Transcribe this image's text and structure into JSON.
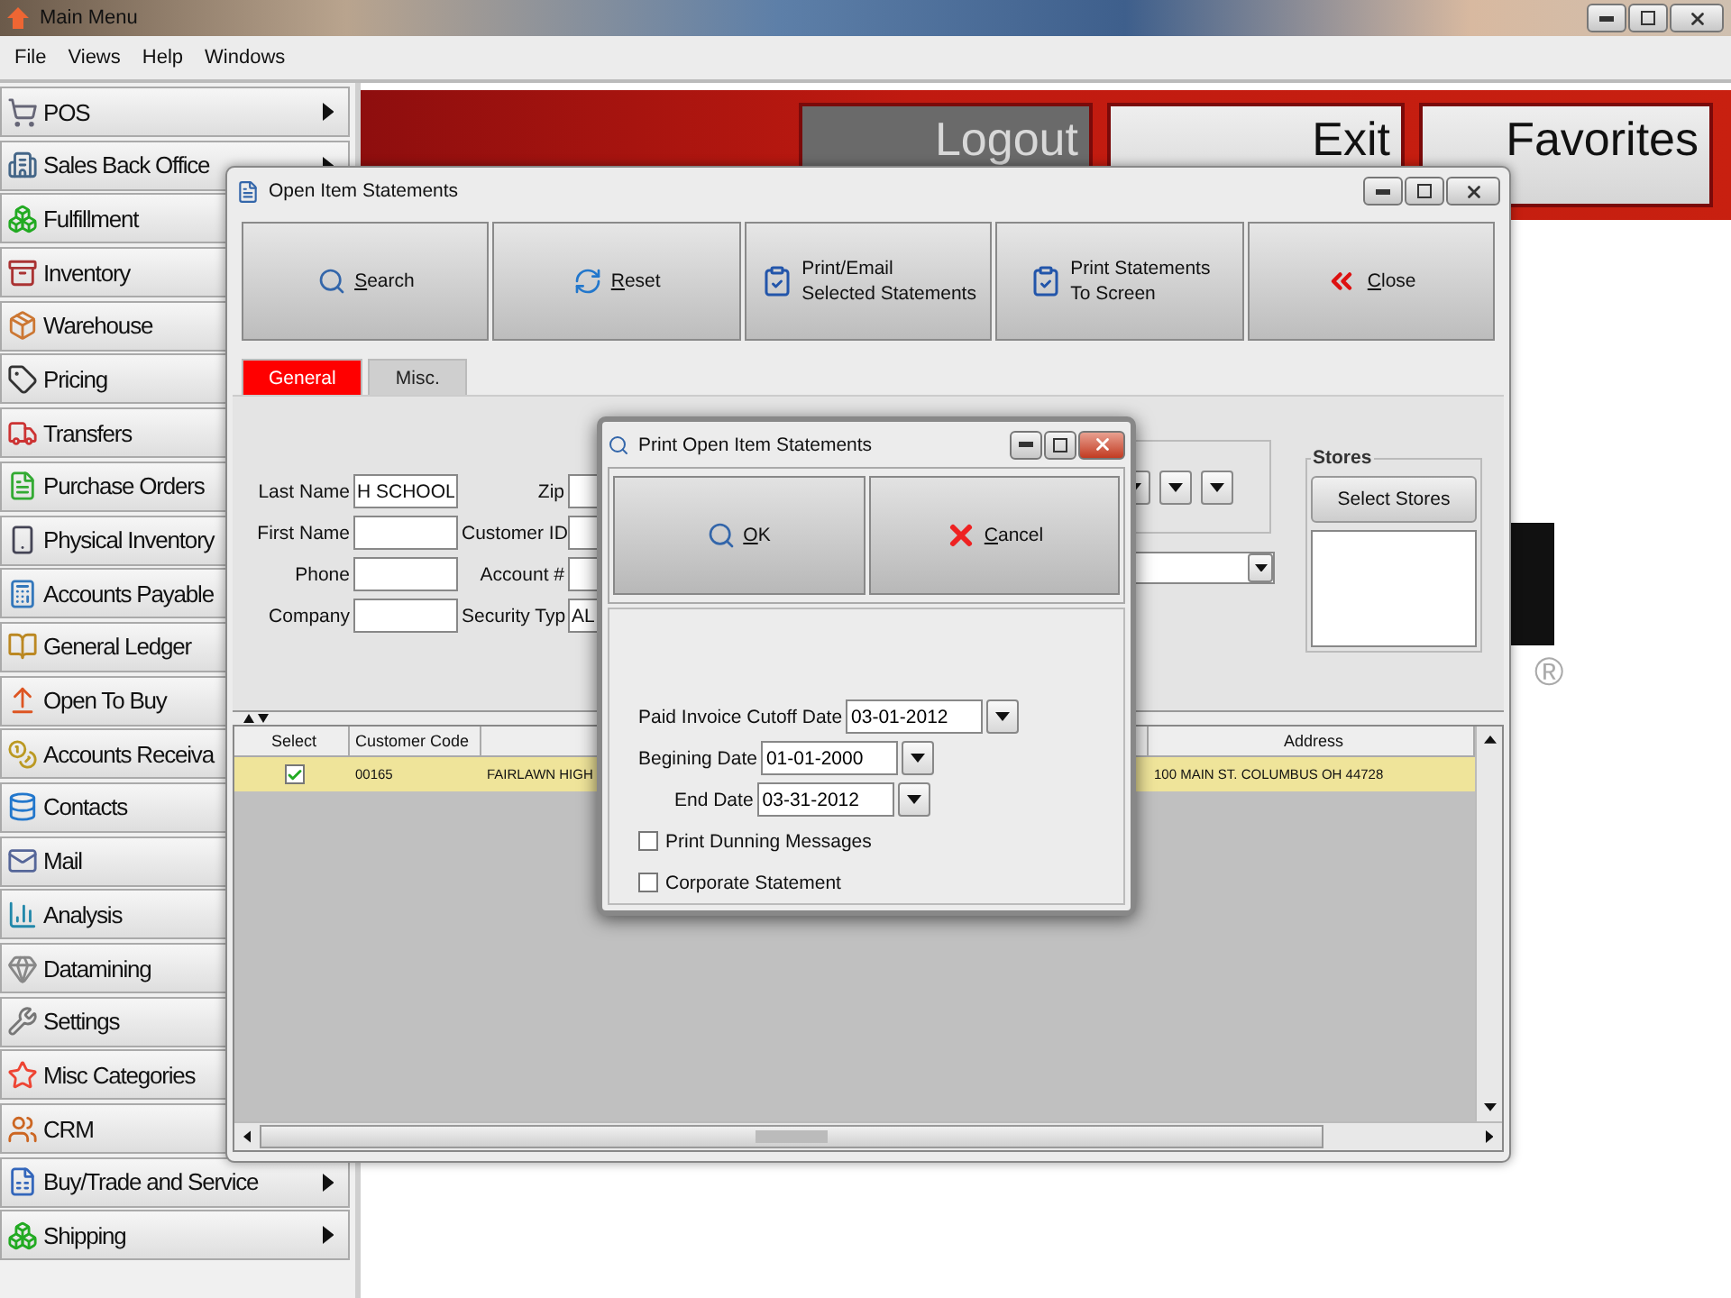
{
  "main_window": {
    "title": "Main Menu"
  },
  "menu_bar": [
    {
      "label": "File"
    },
    {
      "label": "Views"
    },
    {
      "label": "Help"
    },
    {
      "label": "Windows"
    }
  ],
  "sidebar": {
    "items": [
      {
        "label": "POS",
        "submenu": true
      },
      {
        "label": "Sales Back Office",
        "submenu": true
      },
      {
        "label": "Fulfillment",
        "submenu": false
      },
      {
        "label": "Inventory",
        "submenu": false
      },
      {
        "label": "Warehouse",
        "submenu": false
      },
      {
        "label": "Pricing",
        "submenu": false
      },
      {
        "label": "Transfers",
        "submenu": false
      },
      {
        "label": "Purchase Orders",
        "submenu": false
      },
      {
        "label": "Physical Inventory",
        "submenu": false
      },
      {
        "label": "Accounts Payable",
        "submenu": false
      },
      {
        "label": "General Ledger",
        "submenu": false
      },
      {
        "label": "Open To Buy",
        "submenu": false
      },
      {
        "label": "Accounts Receiva",
        "submenu": false
      },
      {
        "label": "Contacts",
        "submenu": false
      },
      {
        "label": "Mail",
        "submenu": false
      },
      {
        "label": "Analysis",
        "submenu": false
      },
      {
        "label": "Datamining",
        "submenu": false
      },
      {
        "label": "Settings",
        "submenu": false
      },
      {
        "label": "Misc Categories",
        "submenu": false
      },
      {
        "label": "CRM",
        "submenu": false
      },
      {
        "label": "Buy/Trade and Service",
        "submenu": true
      },
      {
        "label": "Shipping",
        "submenu": true
      }
    ]
  },
  "banner": {
    "buttons": [
      {
        "label": "Logout",
        "kind": "dark"
      },
      {
        "label": "Exit",
        "kind": "light"
      },
      {
        "label": "Favorites",
        "kind": "light"
      }
    ]
  },
  "logo_mark": "®",
  "statements_window": {
    "title": "Open Item Statements",
    "toolbar": [
      {
        "kind": "search",
        "lines": [
          "Search"
        ],
        "mnemonic": true
      },
      {
        "kind": "reset",
        "lines": [
          "Reset"
        ],
        "mnemonic": true
      },
      {
        "kind": "print",
        "lines": [
          "Print/Email",
          "Selected Statements"
        ],
        "mnemonic": false
      },
      {
        "kind": "print",
        "lines": [
          "Print Statements",
          "To Screen"
        ],
        "mnemonic": false
      },
      {
        "kind": "close",
        "lines": [
          "Close"
        ],
        "mnemonic": true
      }
    ],
    "tabs": [
      {
        "label": "General",
        "selected": true
      },
      {
        "label": "Misc.",
        "selected": false
      }
    ],
    "fields_left": [
      {
        "label": "Last Name",
        "value": "H SCHOOL"
      },
      {
        "label": "First Name"
      },
      {
        "label": "Phone"
      },
      {
        "label": "Company"
      }
    ],
    "fields_right": [
      {
        "label": "Zip"
      },
      {
        "label": "Customer ID"
      },
      {
        "label": "Account #"
      },
      {
        "label": "Security Typ",
        "value": "AL"
      }
    ],
    "stores": {
      "title": "Stores",
      "button": "Select Stores"
    },
    "grid": {
      "columns": [
        {
          "label": "Select",
          "kind": "check"
        },
        {
          "label": "Customer Code",
          "kind": "text"
        },
        {
          "kind": "text"
        },
        {
          "label": "Address",
          "kind": "text"
        }
      ],
      "rows": [
        {
          "selected": true,
          "checked": true,
          "cells": [
            "",
            "00165",
            "FAIRLAWN HIGH",
            "100 MAIN ST.  COLUMBUS OH 44728"
          ]
        }
      ]
    }
  },
  "dialog": {
    "title": "Print Open Item Statements",
    "buttons": [
      {
        "kind": "ok",
        "label": "OK"
      },
      {
        "kind": "cancel",
        "label": "Cancel"
      }
    ],
    "dates": [
      {
        "label": "Paid Invoice Cutoff Date",
        "value": "03-01-2012"
      },
      {
        "label": "Begining Date",
        "value": "01-01-2000"
      },
      {
        "label": "End Date",
        "value": "03-31-2012"
      }
    ],
    "options": [
      {
        "label": "Print Dunning Messages",
        "checked": false
      },
      {
        "label": "Corporate Statement",
        "checked": false
      }
    ]
  }
}
